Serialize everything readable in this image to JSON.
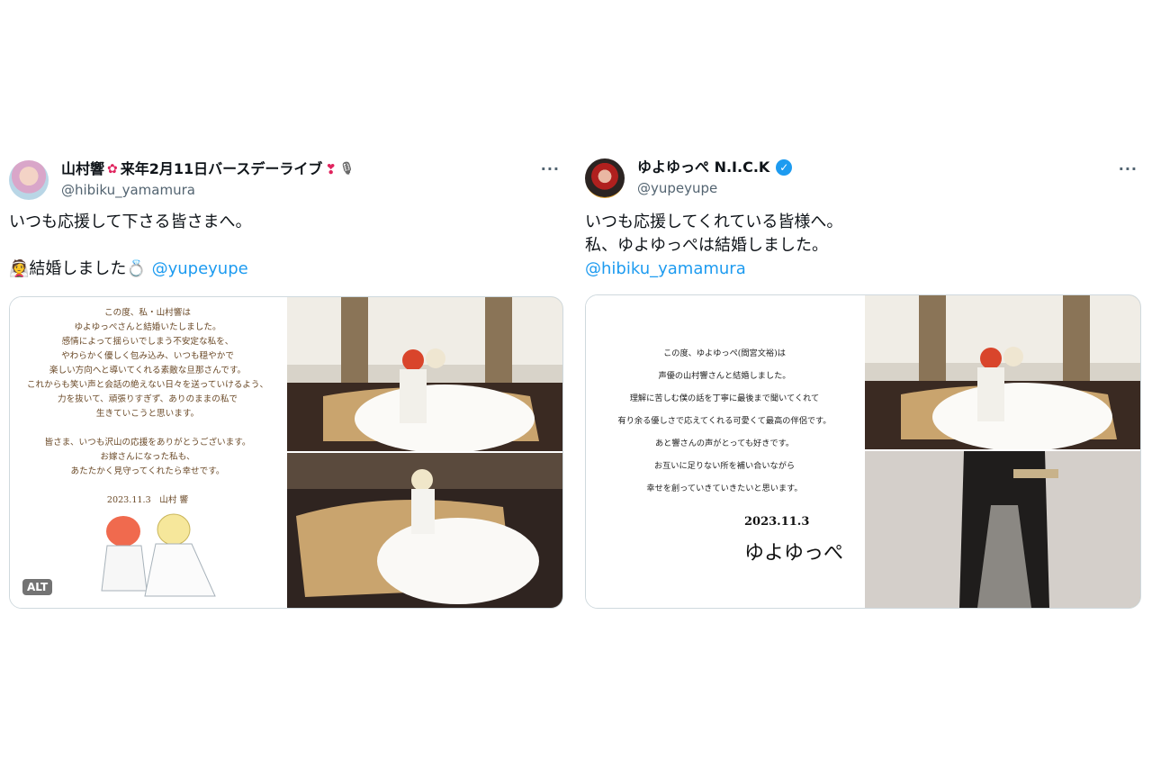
{
  "tweet1": {
    "display_name": "山村響",
    "display_suffix": "来年2月11日バースデーライブ",
    "handle": "@hibiku_yamamura",
    "more": "···",
    "line1": "いつも応援して下さる皆さまへ。",
    "line2_text": "結婚しました",
    "mention": "@yupeyupe",
    "alt_label": "ALT",
    "letter": [
      "この度、私・山村響は",
      "ゆよゆっぺさんと結婚いたしました。",
      "感情によって揺らいでしまう不安定な私を、",
      "やわらかく優しく包み込み、いつも穏やかで",
      "楽しい方向へと導いてくれる素敵な旦那さんです。",
      "これからも笑い声と会話の絶えない日々を送っていけるよう、",
      "力を抜いて、頑張りすぎず、ありのままの私で",
      "生きていこうと思います。",
      "",
      "皆さま、いつも沢山の応援をありがとうございます。",
      "お嫁さんになった私も、",
      "あたたかく見守ってくれたら幸せです。",
      "",
      "2023.11.3　山村 響"
    ]
  },
  "tweet2": {
    "display_name": "ゆよゆっぺ N.I.C.K",
    "handle": "@yupeyupe",
    "more": "···",
    "line1": "いつも応援してくれている皆様へ。",
    "line2": "私、ゆよゆっぺは結婚しました。",
    "mention": "@hibiku_yamamura",
    "letter": [
      "この度、ゆよゆっぺ(間宮文裕)は",
      "声優の山村響さんと結婚しました。",
      "理解に苦しむ僕の話を丁寧に最後まで聞いてくれて",
      "有り余る優しさで応えてくれる可愛くて最高の伴侶です。",
      "あと響さんの声がとっても好きです。",
      "お互いに足りない所を補い合いながら",
      "幸せを創っていきていきたいと思います。"
    ],
    "sig_date": "2023.11.3",
    "sig_name": "ゆよゆっぺ"
  },
  "colors": {
    "link": "#1d9bf0",
    "text": "#0f1419",
    "muted": "#536471",
    "verified": "#1d9bf0"
  },
  "icons": [
    "heart-emoji-icon",
    "microphone-icon",
    "verified-icon",
    "more-icon",
    "ring-icon",
    "bride-icon"
  ]
}
